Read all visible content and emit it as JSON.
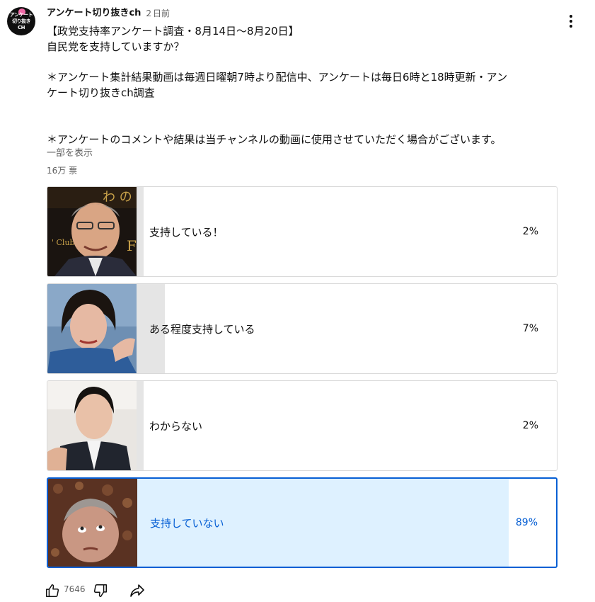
{
  "channel": {
    "name": "アンケート切り抜きch",
    "posted": "２日前",
    "avatar_lines": [
      "アンケート",
      "切り抜き",
      "CH"
    ]
  },
  "post": {
    "title": "【政党支持率アンケート調査・8月14日～8月20日】",
    "question": "自民党を支持していますか？",
    "note1_line1": "＊アンケート集計結果動画は毎週日曜朝7時より配信中、アンケートは毎日6時と18時更新・アン",
    "note1_line2": "ケート切り抜きch調査",
    "note2": "＊アンケートのコメントや結果は当チャンネルの動画に使用させていただく場合がございます。",
    "show_more": "一部を表示",
    "votes": "16万 票"
  },
  "poll": {
    "options": [
      {
        "label": "支持している！",
        "percent_text": "2%",
        "percent": 2,
        "selected": false
      },
      {
        "label": "ある程度支持している",
        "percent_text": "7%",
        "percent": 7,
        "selected": false
      },
      {
        "label": "わからない",
        "percent_text": "2%",
        "percent": 2,
        "selected": false
      },
      {
        "label": "支持していない",
        "percent_text": "89%",
        "percent": 89,
        "selected": true
      }
    ]
  },
  "actions": {
    "like_count": "7646",
    "icons": [
      "like-icon",
      "dislike-icon",
      "share-icon"
    ]
  },
  "colors": {
    "accent": "#065fd4",
    "selected_fill": "#def1ff",
    "result_fill": "#e5e5e5"
  }
}
